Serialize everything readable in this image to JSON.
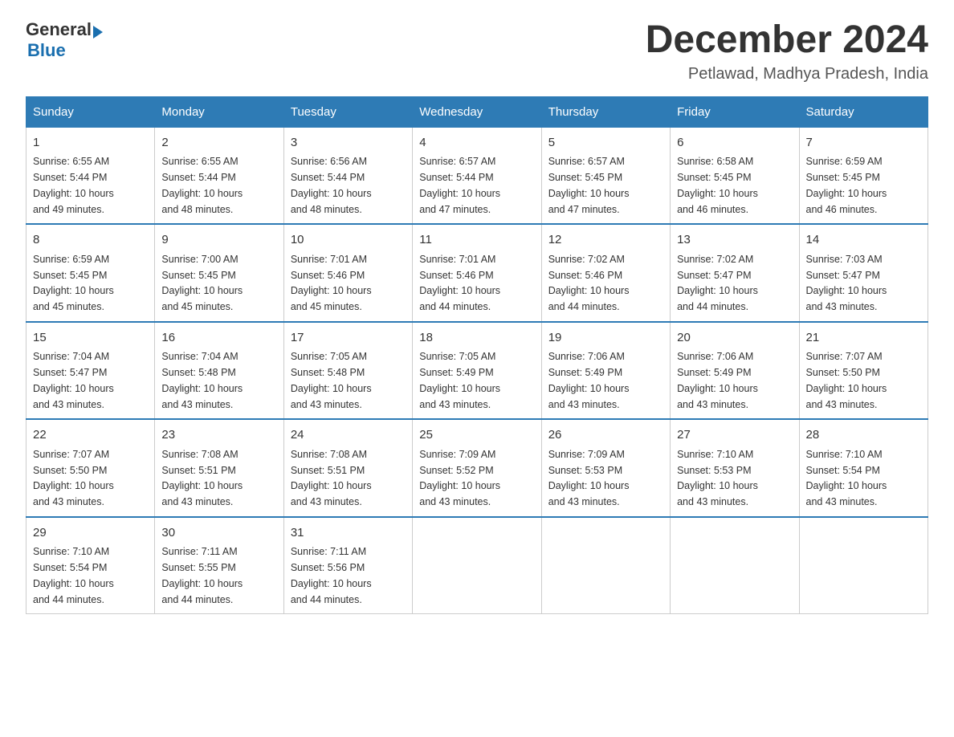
{
  "header": {
    "logo_general": "General",
    "logo_blue": "Blue",
    "main_title": "December 2024",
    "subtitle": "Petlawad, Madhya Pradesh, India"
  },
  "columns": [
    "Sunday",
    "Monday",
    "Tuesday",
    "Wednesday",
    "Thursday",
    "Friday",
    "Saturday"
  ],
  "weeks": [
    [
      {
        "day": "1",
        "sunrise": "6:55 AM",
        "sunset": "5:44 PM",
        "daylight": "10 hours and 49 minutes."
      },
      {
        "day": "2",
        "sunrise": "6:55 AM",
        "sunset": "5:44 PM",
        "daylight": "10 hours and 48 minutes."
      },
      {
        "day": "3",
        "sunrise": "6:56 AM",
        "sunset": "5:44 PM",
        "daylight": "10 hours and 48 minutes."
      },
      {
        "day": "4",
        "sunrise": "6:57 AM",
        "sunset": "5:44 PM",
        "daylight": "10 hours and 47 minutes."
      },
      {
        "day": "5",
        "sunrise": "6:57 AM",
        "sunset": "5:45 PM",
        "daylight": "10 hours and 47 minutes."
      },
      {
        "day": "6",
        "sunrise": "6:58 AM",
        "sunset": "5:45 PM",
        "daylight": "10 hours and 46 minutes."
      },
      {
        "day": "7",
        "sunrise": "6:59 AM",
        "sunset": "5:45 PM",
        "daylight": "10 hours and 46 minutes."
      }
    ],
    [
      {
        "day": "8",
        "sunrise": "6:59 AM",
        "sunset": "5:45 PM",
        "daylight": "10 hours and 45 minutes."
      },
      {
        "day": "9",
        "sunrise": "7:00 AM",
        "sunset": "5:45 PM",
        "daylight": "10 hours and 45 minutes."
      },
      {
        "day": "10",
        "sunrise": "7:01 AM",
        "sunset": "5:46 PM",
        "daylight": "10 hours and 45 minutes."
      },
      {
        "day": "11",
        "sunrise": "7:01 AM",
        "sunset": "5:46 PM",
        "daylight": "10 hours and 44 minutes."
      },
      {
        "day": "12",
        "sunrise": "7:02 AM",
        "sunset": "5:46 PM",
        "daylight": "10 hours and 44 minutes."
      },
      {
        "day": "13",
        "sunrise": "7:02 AM",
        "sunset": "5:47 PM",
        "daylight": "10 hours and 44 minutes."
      },
      {
        "day": "14",
        "sunrise": "7:03 AM",
        "sunset": "5:47 PM",
        "daylight": "10 hours and 43 minutes."
      }
    ],
    [
      {
        "day": "15",
        "sunrise": "7:04 AM",
        "sunset": "5:47 PM",
        "daylight": "10 hours and 43 minutes."
      },
      {
        "day": "16",
        "sunrise": "7:04 AM",
        "sunset": "5:48 PM",
        "daylight": "10 hours and 43 minutes."
      },
      {
        "day": "17",
        "sunrise": "7:05 AM",
        "sunset": "5:48 PM",
        "daylight": "10 hours and 43 minutes."
      },
      {
        "day": "18",
        "sunrise": "7:05 AM",
        "sunset": "5:49 PM",
        "daylight": "10 hours and 43 minutes."
      },
      {
        "day": "19",
        "sunrise": "7:06 AM",
        "sunset": "5:49 PM",
        "daylight": "10 hours and 43 minutes."
      },
      {
        "day": "20",
        "sunrise": "7:06 AM",
        "sunset": "5:49 PM",
        "daylight": "10 hours and 43 minutes."
      },
      {
        "day": "21",
        "sunrise": "7:07 AM",
        "sunset": "5:50 PM",
        "daylight": "10 hours and 43 minutes."
      }
    ],
    [
      {
        "day": "22",
        "sunrise": "7:07 AM",
        "sunset": "5:50 PM",
        "daylight": "10 hours and 43 minutes."
      },
      {
        "day": "23",
        "sunrise": "7:08 AM",
        "sunset": "5:51 PM",
        "daylight": "10 hours and 43 minutes."
      },
      {
        "day": "24",
        "sunrise": "7:08 AM",
        "sunset": "5:51 PM",
        "daylight": "10 hours and 43 minutes."
      },
      {
        "day": "25",
        "sunrise": "7:09 AM",
        "sunset": "5:52 PM",
        "daylight": "10 hours and 43 minutes."
      },
      {
        "day": "26",
        "sunrise": "7:09 AM",
        "sunset": "5:53 PM",
        "daylight": "10 hours and 43 minutes."
      },
      {
        "day": "27",
        "sunrise": "7:10 AM",
        "sunset": "5:53 PM",
        "daylight": "10 hours and 43 minutes."
      },
      {
        "day": "28",
        "sunrise": "7:10 AM",
        "sunset": "5:54 PM",
        "daylight": "10 hours and 43 minutes."
      }
    ],
    [
      {
        "day": "29",
        "sunrise": "7:10 AM",
        "sunset": "5:54 PM",
        "daylight": "10 hours and 44 minutes."
      },
      {
        "day": "30",
        "sunrise": "7:11 AM",
        "sunset": "5:55 PM",
        "daylight": "10 hours and 44 minutes."
      },
      {
        "day": "31",
        "sunrise": "7:11 AM",
        "sunset": "5:56 PM",
        "daylight": "10 hours and 44 minutes."
      },
      null,
      null,
      null,
      null
    ]
  ],
  "labels": {
    "sunrise": "Sunrise:",
    "sunset": "Sunset:",
    "daylight": "Daylight:"
  }
}
